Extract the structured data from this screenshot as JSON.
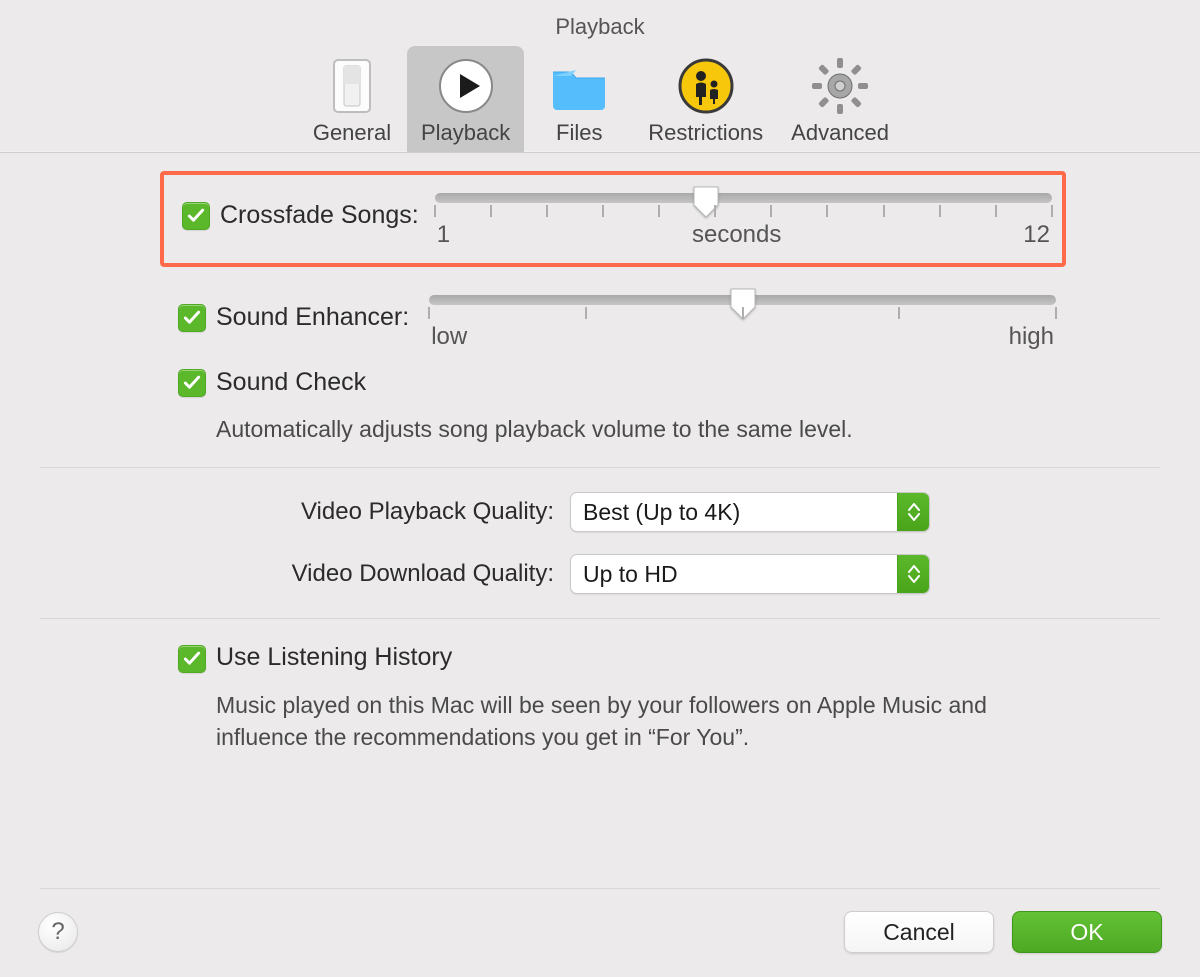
{
  "window": {
    "title": "Playback"
  },
  "tabs": {
    "general": "General",
    "playback": "Playback",
    "files": "Files",
    "restrictions": "Restrictions",
    "advanced": "Advanced",
    "selected": "playback"
  },
  "crossfade": {
    "checked": true,
    "label": "Crossfade Songs:",
    "min_label": "1",
    "center_label": "seconds",
    "max_label": "12",
    "value_percent": 44
  },
  "enhancer": {
    "checked": true,
    "label": "Sound Enhancer:",
    "min_label": "low",
    "max_label": "high",
    "value_percent": 50
  },
  "soundcheck": {
    "checked": true,
    "label": "Sound Check",
    "desc": "Automatically adjusts song playback volume to the same level."
  },
  "video": {
    "playback_label": "Video Playback Quality:",
    "playback_value": "Best (Up to 4K)",
    "download_label": "Video Download Quality:",
    "download_value": "Up to HD"
  },
  "history": {
    "checked": true,
    "label": "Use Listening History",
    "desc": "Music played on this Mac will be seen by your followers on Apple Music and influence the recommendations you get in “For You”."
  },
  "buttons": {
    "help": "?",
    "cancel": "Cancel",
    "ok": "OK"
  }
}
